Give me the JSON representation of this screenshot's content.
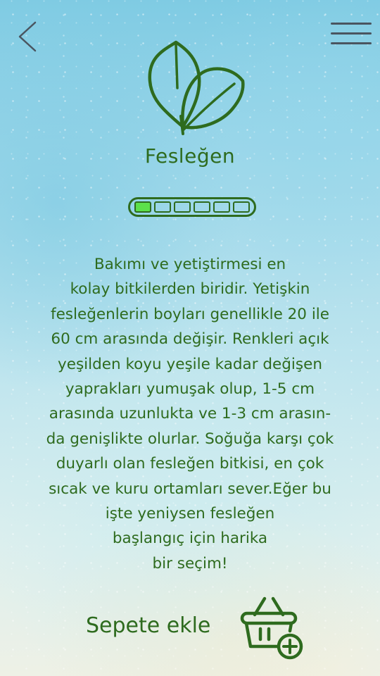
{
  "header": {
    "back_icon": "chevron-left-icon",
    "menu_icon": "hamburger-menu-icon"
  },
  "plant": {
    "icon": "leaf-icon",
    "name": "Fesleğen",
    "care_level": {
      "filled": 1,
      "total": 6
    },
    "description": "Bakımı ve yetiştirmesi en\nkolay bitkilerden biridir. Yetişkin\nfesleğenlerin boyları genellikle 20 ile\n60 cm arasında değişir. Renkleri açık\nyeşilden koyu yeşile kadar değişen\nyaprakları yumuşak olup, 1-5 cm\narasında uzunlukta ve 1-3 cm arasın-\nda genişlikte olurlar. Soğuğa karşı çok\nduyarlı olan fesleğen bitkisi, en çok\nsıcak ve kuru ortamları sever.Eğer bu\nişte yeniysen fesleğen\nbaşlangıç için harika\nbir seçim!"
  },
  "cart": {
    "label": "Sepete ekle",
    "icon": "basket-add-icon"
  },
  "colors": {
    "primary_green": "#2e6b1e",
    "level_fill": "#5ce04a",
    "menu_gray": "#4a5560"
  }
}
